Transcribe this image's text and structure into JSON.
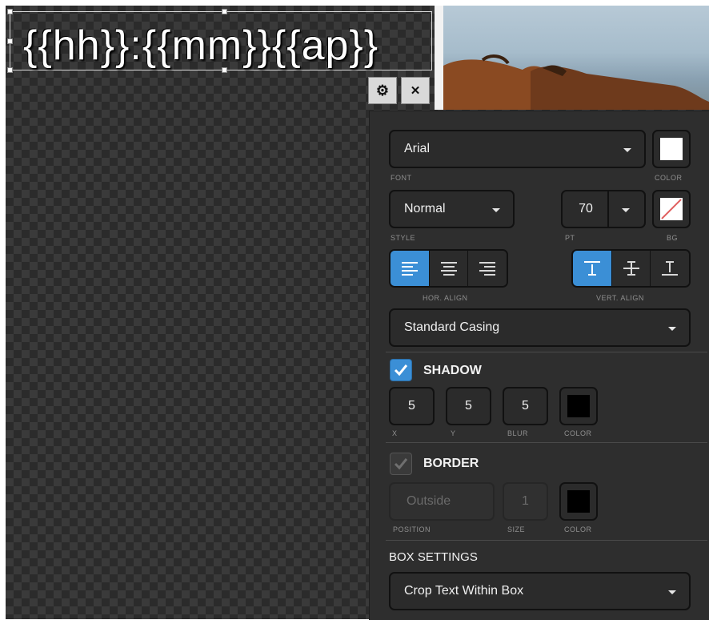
{
  "canvas": {
    "template_text": "{{hh}}:{{mm}}{{ap}}",
    "buttons": {
      "settings_icon": "gear-icon",
      "close_icon": "close-icon",
      "close_glyph": "✕",
      "settings_glyph": "⚙"
    }
  },
  "panel": {
    "font": {
      "value": "Arial",
      "label": "FONT"
    },
    "color": {
      "label": "COLOR",
      "value": "#ffffff"
    },
    "style": {
      "value": "Normal",
      "label": "STYLE"
    },
    "pt": {
      "value": "70",
      "label": "PT"
    },
    "bg": {
      "label": "BG"
    },
    "hor_align": {
      "label": "HOR. ALIGN",
      "options": [
        "left",
        "center",
        "right"
      ],
      "selected": "left"
    },
    "vert_align": {
      "label": "VERT. ALIGN",
      "options": [
        "top",
        "middle",
        "bottom"
      ],
      "selected": "top"
    },
    "casing": {
      "value": "Standard Casing"
    },
    "shadow": {
      "label": "SHADOW",
      "checked": true,
      "x": "5",
      "y": "5",
      "blur": "5",
      "x_label": "X",
      "y_label": "Y",
      "blur_label": "BLUR",
      "color_label": "COLOR",
      "color": "#000000"
    },
    "border": {
      "label": "BORDER",
      "checked": false,
      "position": "Outside",
      "size": "1",
      "position_label": "POSITION",
      "size_label": "SIZE",
      "color_label": "COLOR",
      "color": "#000000"
    },
    "box_settings": {
      "label": "BOX SETTINGS",
      "value": "Crop Text Within Box"
    }
  },
  "colors": {
    "accent": "#3b8fd6"
  }
}
